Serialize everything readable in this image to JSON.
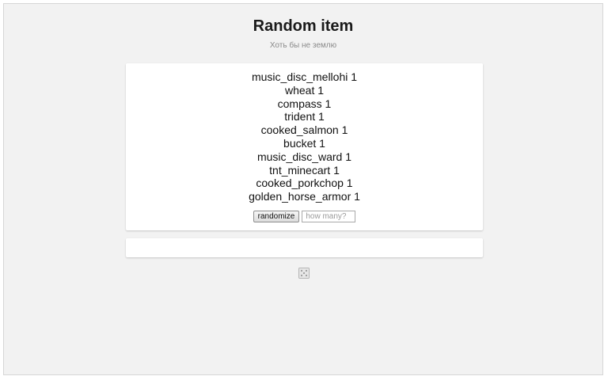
{
  "header": {
    "title": "Random item",
    "subtitle": "Хоть бы не землю"
  },
  "results": {
    "items": [
      "music_disc_mellohi 1",
      "wheat 1",
      "compass 1",
      "trident 1",
      "cooked_salmon 1",
      "bucket 1",
      "music_disc_ward 1",
      "tnt_minecart 1",
      "cooked_porkchop 1",
      "golden_horse_armor 1"
    ]
  },
  "controls": {
    "randomize_label": "randomize",
    "count_placeholder": "how many?",
    "count_value": ""
  },
  "footer": {
    "icon": "dice-icon"
  }
}
